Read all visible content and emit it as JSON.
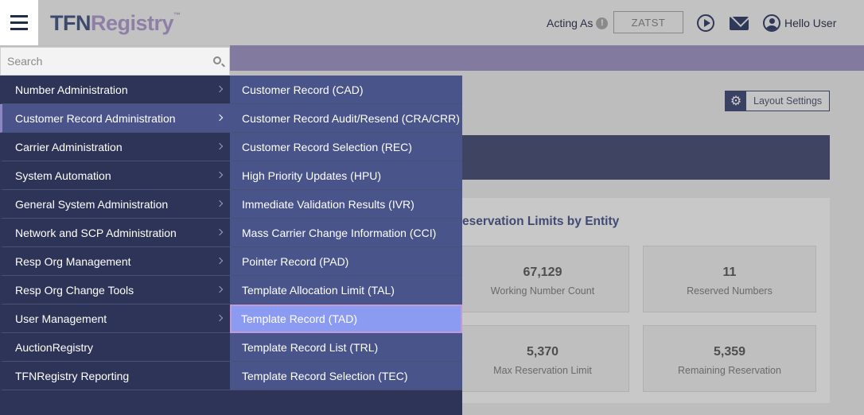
{
  "header": {
    "logo_part1": "TFN",
    "logo_part2": "Registry",
    "logo_tm": "™",
    "acting_as_label": "Acting As",
    "acting_as_value": "ZATST",
    "greeting": "Hello User"
  },
  "search": {
    "placeholder": "Search"
  },
  "menu": {
    "primary": [
      {
        "label": "Number Administration",
        "has_submenu": true
      },
      {
        "label": "Customer Record Administration",
        "has_submenu": true,
        "active": true
      },
      {
        "label": "Carrier Administration",
        "has_submenu": true
      },
      {
        "label": "System Automation",
        "has_submenu": true
      },
      {
        "label": "General System Administration",
        "has_submenu": true
      },
      {
        "label": "Network and SCP Administration",
        "has_submenu": true
      },
      {
        "label": "Resp Org Management",
        "has_submenu": true
      },
      {
        "label": "Resp Org Change Tools",
        "has_submenu": true
      },
      {
        "label": "User Management",
        "has_submenu": true
      },
      {
        "label": "AuctionRegistry",
        "has_submenu": false
      },
      {
        "label": "TFNRegistry Reporting",
        "has_submenu": false
      }
    ],
    "secondary": [
      {
        "label": "Customer Record (CAD)"
      },
      {
        "label": "Customer Record Audit/Resend (CRA/CRR)"
      },
      {
        "label": "Customer Record Selection (REC)"
      },
      {
        "label": "High Priority Updates (HPU)"
      },
      {
        "label": "Immediate Validation Results (IVR)"
      },
      {
        "label": "Mass Carrier Change Information (CCI)"
      },
      {
        "label": "Pointer Record (PAD)"
      },
      {
        "label": "Template Allocation Limit (TAL)"
      },
      {
        "label": "Template Record (TAD)",
        "selected": true
      },
      {
        "label": "Template Record List (TRL)"
      },
      {
        "label": "Template Record Selection (TEC)"
      }
    ]
  },
  "page": {
    "layout_settings_label": "Layout Settings",
    "panel_title": "eservation Limits by Entity",
    "stats": [
      {
        "value": "67,129",
        "label": "Working Number Count"
      },
      {
        "value": "11",
        "label": "Reserved Numbers"
      },
      {
        "value": "5,370",
        "label": "Max Reservation Limit"
      },
      {
        "value": "5,359",
        "label": "Remaining Reservation"
      }
    ]
  },
  "colors": {
    "menu_bg": "#2e3457",
    "submenu_bg": "#49548a",
    "selected_bg": "#8c9bf2",
    "accent_band": "#837a9f"
  }
}
